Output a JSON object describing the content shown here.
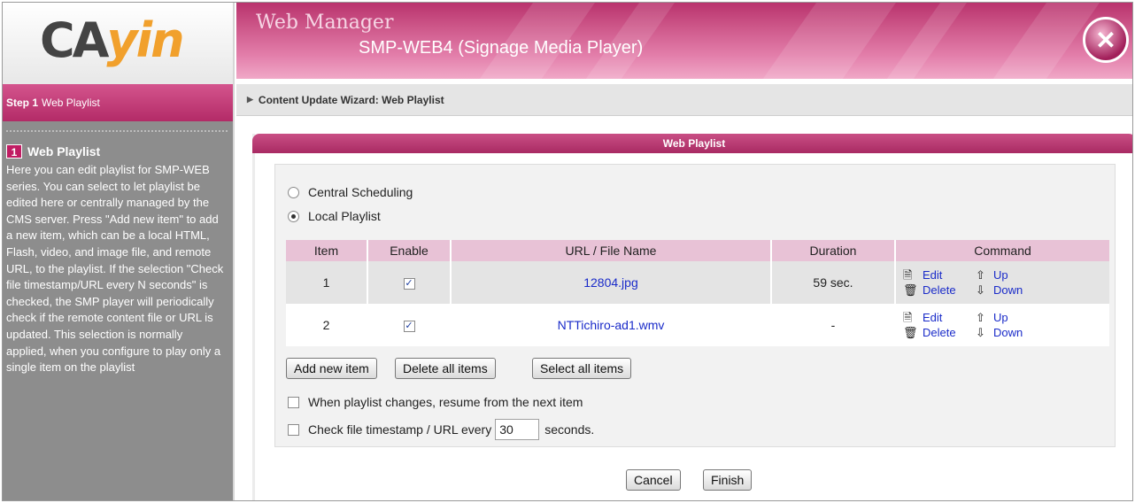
{
  "brand": {
    "logo_left": "CA",
    "logo_right": "yin"
  },
  "header": {
    "app_name": "Web Manager",
    "device": "SMP-WEB4 (Signage Media Player)"
  },
  "sidebar": {
    "step_label": "Step 1",
    "step_name": "Web Playlist",
    "section_number": "1",
    "section_title": "Web Playlist",
    "description": "Here you can edit playlist for SMP-WEB series. You can select to let playlist be edited here or centrally managed by the CMS server. Press \"Add new item\" to add a new item, which can be a local HTML, Flash, video, and image file, and remote URL, to the playlist. If the selection \"Check file timestamp/URL every N seconds\" is checked, the SMP player will periodically check if the remote content file or URL is updated. This selection is normally applied, when you configure to play only a single item on the playlist"
  },
  "breadcrumb": "Content Update Wizard: Web Playlist",
  "panel": {
    "title": "Web Playlist",
    "mode_options": [
      {
        "label": "Central Scheduling",
        "selected": false
      },
      {
        "label": "Local Playlist",
        "selected": true
      }
    ],
    "columns": [
      "Item",
      "Enable",
      "URL / File Name",
      "Duration",
      "Command"
    ],
    "rows": [
      {
        "item": "1",
        "enabled": true,
        "file": "12804.jpg",
        "duration": "59 sec.",
        "edit": "Edit",
        "delete": "Delete",
        "up": "Up",
        "down": "Down"
      },
      {
        "item": "2",
        "enabled": true,
        "file": "NTTichiro-ad1.wmv",
        "duration": "-",
        "edit": "Edit",
        "delete": "Delete",
        "up": "Up",
        "down": "Down"
      }
    ],
    "buttons": {
      "add": "Add new item",
      "delete_all": "Delete all items",
      "select_all": "Select all items"
    },
    "resume_option": {
      "label": "When playlist changes, resume from the next item",
      "checked": false
    },
    "timestamp_option": {
      "label_before": "Check file timestamp / URL every",
      "value": "30",
      "label_after": "seconds.",
      "checked": false
    }
  },
  "footer": {
    "cancel": "Cancel",
    "finish": "Finish"
  }
}
